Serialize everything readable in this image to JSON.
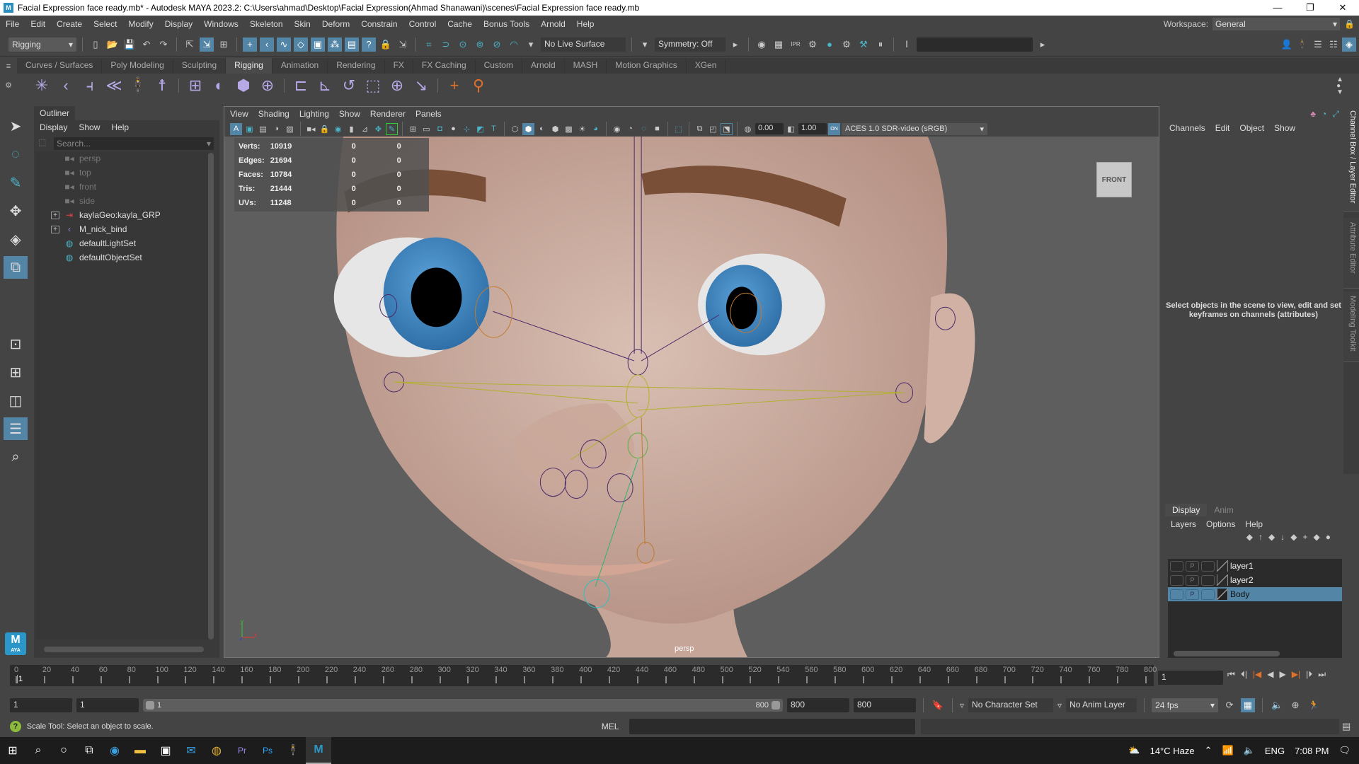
{
  "window": {
    "title": "Facial Expression face ready.mb* - Autodesk MAYA 2023.2: C:\\Users\\ahmad\\Desktop\\Facial Expression(Ahmad Shanawani)\\scenes\\Facial Expression face ready.mb",
    "app_icon": "M",
    "controls": {
      "minimize": "—",
      "restore": "❐",
      "close": "✕"
    }
  },
  "menubar": {
    "items": [
      "File",
      "Edit",
      "Create",
      "Select",
      "Modify",
      "Display",
      "Windows",
      "Skeleton",
      "Skin",
      "Deform",
      "Constrain",
      "Control",
      "Cache",
      "Bonus Tools",
      "Arnold",
      "Help"
    ],
    "workspace_label": "Workspace:",
    "workspace_value": "General"
  },
  "statusline": {
    "menuset": "Rigging",
    "live_surface": "No Live Surface",
    "symmetry": "Symmetry: Off",
    "ipr_label": "IPR"
  },
  "shelf": {
    "tabs": [
      "Curves / Surfaces",
      "Poly Modeling",
      "Sculpting",
      "Rigging",
      "Animation",
      "Rendering",
      "FX",
      "FX Caching",
      "Custom",
      "Arnold",
      "MASH",
      "Motion Graphics",
      "XGen"
    ],
    "active_tab": "Rigging",
    "tools": [
      "create-joints",
      "ik-handle",
      "ik-spline",
      "insert-joint",
      "humanik",
      "quick-rig",
      "bind-skin",
      "paint-weights",
      "lattice",
      "cluster",
      "parent-constraint",
      "point-constraint",
      "orient-constraint",
      "scale-constraint",
      "aim-constraint",
      "pole-vector",
      "locator",
      "parent-link"
    ]
  },
  "toolbox": {
    "tools": [
      "select-tool",
      "lasso-tool",
      "paint-select-tool",
      "move-tool",
      "rotate-tool",
      "scale-tool"
    ],
    "active_tool": "scale-tool",
    "layouts": [
      "single-perspective",
      "four-view",
      "two-pane",
      "outliner-persp"
    ],
    "active_layout": "outliner-persp",
    "logo_text": "M",
    "logo_sub": "AYA"
  },
  "outliner": {
    "title": "Outliner",
    "menu": [
      "Display",
      "Show",
      "Help"
    ],
    "search_placeholder": "Search...",
    "items": [
      {
        "label": "persp",
        "type": "camera",
        "dim": true,
        "expandable": false
      },
      {
        "label": "top",
        "type": "camera",
        "dim": true,
        "expandable": false
      },
      {
        "label": "front",
        "type": "camera",
        "dim": true,
        "expandable": false
      },
      {
        "label": "side",
        "type": "camera",
        "dim": true,
        "expandable": false
      },
      {
        "label": "kaylaGeo:kayla_GRP",
        "type": "transform",
        "dim": false,
        "expandable": true
      },
      {
        "label": "M_nick_bind",
        "type": "joint",
        "dim": false,
        "expandable": true
      },
      {
        "label": "defaultLightSet",
        "type": "set",
        "dim": false,
        "expandable": false
      },
      {
        "label": "defaultObjectSet",
        "type": "set",
        "dim": false,
        "expandable": false
      }
    ]
  },
  "viewport": {
    "menu": [
      "View",
      "Shading",
      "Lighting",
      "Show",
      "Renderer",
      "Panels"
    ],
    "exposure": "0.00",
    "gamma": "1.00",
    "color_mgmt_on": "ON",
    "color_space": "ACES 1.0 SDR-video (sRGB)",
    "hud": [
      {
        "label": "Verts:",
        "value": "10919",
        "c1": "0",
        "c2": "0"
      },
      {
        "label": "Edges:",
        "value": "21694",
        "c1": "0",
        "c2": "0"
      },
      {
        "label": "Faces:",
        "value": "10784",
        "c1": "0",
        "c2": "0"
      },
      {
        "label": "Tris:",
        "value": "21444",
        "c1": "0",
        "c2": "0"
      },
      {
        "label": "UVs:",
        "value": "11248",
        "c1": "0",
        "c2": "0"
      }
    ],
    "camera_label": "persp",
    "viewcube_label": "FRONT",
    "axis": {
      "x": "x",
      "y": "y",
      "z": "z"
    }
  },
  "channelbox": {
    "menu": [
      "Channels",
      "Edit",
      "Object",
      "Show"
    ],
    "empty_message": "Select objects in the scene to view, edit and set keyframes on channels (attributes)"
  },
  "side_tabs": [
    "Channel Box / Layer Editor",
    "Attribute Editor",
    "Modeling Toolkit"
  ],
  "layer_editor": {
    "tabs": [
      "Display",
      "Anim"
    ],
    "active_tab": "Display",
    "menu": [
      "Layers",
      "Options",
      "Help"
    ],
    "layers": [
      {
        "name": "layer1",
        "selected": false,
        "p": "P"
      },
      {
        "name": "layer2",
        "selected": false,
        "p": "P"
      },
      {
        "name": "Body",
        "selected": true,
        "p": "P"
      }
    ]
  },
  "timeline": {
    "ticks": [
      0,
      20,
      40,
      60,
      80,
      100,
      120,
      140,
      160,
      180,
      200,
      220,
      240,
      260,
      280,
      300,
      320,
      340,
      360,
      380,
      400,
      420,
      440,
      460,
      480,
      500,
      520,
      540,
      560,
      580,
      600,
      620,
      640,
      660,
      680,
      700,
      720,
      740,
      760,
      780,
      800
    ],
    "range_start": 0,
    "range_end": 800,
    "current_frame_marker": "1",
    "current_frame": "1",
    "playback_buttons": [
      "⏮",
      "⏴|",
      "|◀",
      "◀",
      "▶",
      "▶|",
      "|⏵",
      "⏭"
    ]
  },
  "range": {
    "start": "1",
    "playback_start": "1",
    "slider_start": "1",
    "slider_end": "800",
    "playback_end": "800",
    "end": "800",
    "character_set": "No Character Set",
    "anim_layer": "No Anim Layer",
    "fps": "24 fps"
  },
  "commandline": {
    "help_text": "Scale Tool: Select an object to scale.",
    "language": "MEL",
    "input_value": ""
  },
  "taskbar": {
    "apps": [
      "start",
      "search",
      "cortana",
      "task-view",
      "edge",
      "file-explorer",
      "store",
      "mail",
      "chrome",
      "premiere-pro",
      "photoshop",
      "zbrush",
      "maya"
    ],
    "app_labels": {
      "premiere-pro": "Pr",
      "photoshop": "Ps",
      "maya": "M"
    },
    "weather": "14°C  Haze",
    "language": "ENG",
    "time": "7:08 PM"
  }
}
